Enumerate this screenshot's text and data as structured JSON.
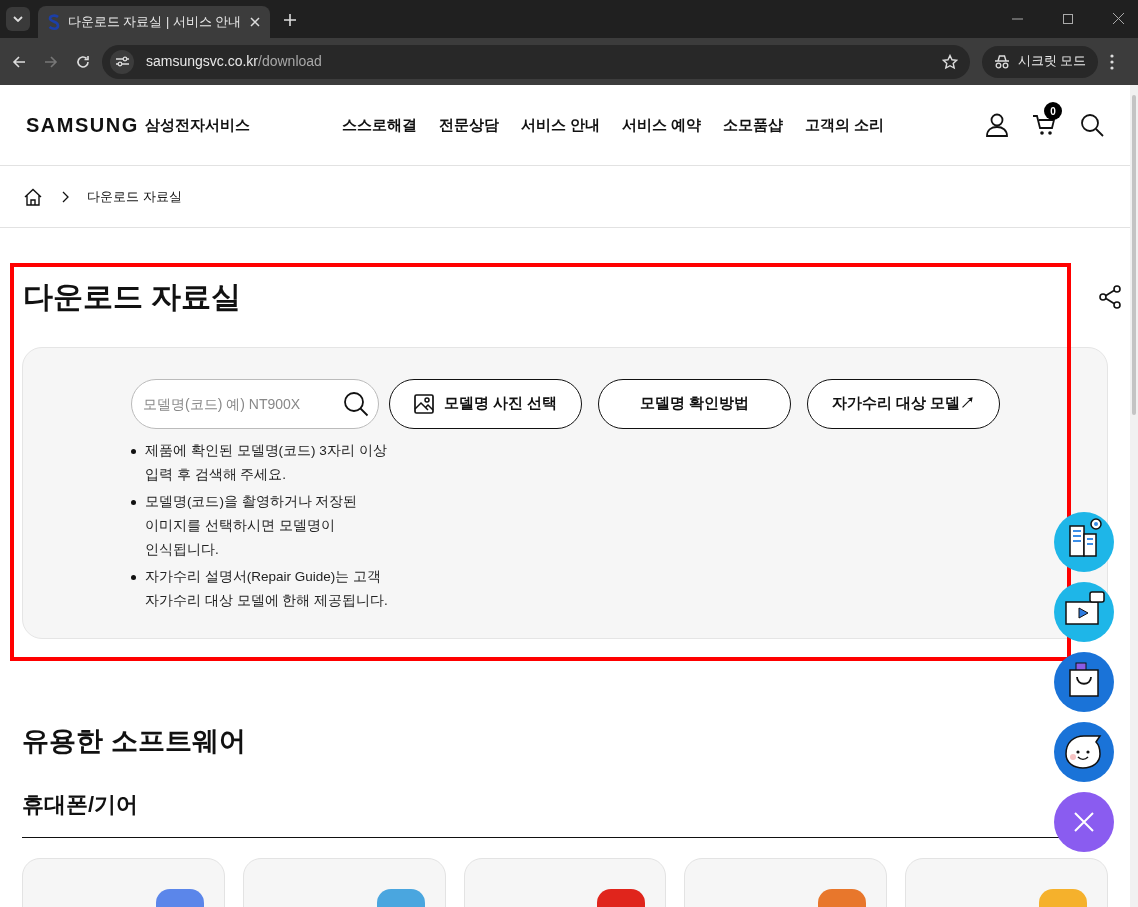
{
  "browser": {
    "tab_title": "다운로드 자료실 | 서비스 안내",
    "url_host": "samsungsvc.co.kr",
    "url_path": "/download",
    "incognito_label": "시크릿 모드"
  },
  "header": {
    "logo": "SAMSUNG",
    "brand": "삼성전자서비스",
    "nav": [
      "스스로해결",
      "전문상담",
      "서비스 안내",
      "서비스 예약",
      "소모품샵",
      "고객의 소리"
    ],
    "cart_count": "0"
  },
  "breadcrumb": [
    "다운로드 자료실"
  ],
  "page_title": "다운로드 자료실",
  "search": {
    "placeholder": "모델명(코드) 예) NT900X",
    "buttons": [
      {
        "kind": "photo",
        "label": "모델명 사진 선택"
      },
      {
        "kind": "plain",
        "label": "모델명 확인방법"
      },
      {
        "kind": "plain",
        "label": "자가수리 대상 모델↗"
      }
    ],
    "notes": [
      "제품에 확인된 모델명(코드) 3자리 이상 입력 후 검색해 주세요.",
      "모델명(코드)을 촬영하거나 저장된 이미지를 선택하시면 모델명이 인식됩니다.",
      "자가수리 설명서(Repair Guide)는 고객 자가수리 대상 모델에 한해 제공됩니다."
    ]
  },
  "software": {
    "title": "유용한 소프트웨어",
    "category": "휴대폰/기어",
    "cards": [
      {
        "color": "#5b86ea"
      },
      {
        "color": "#4aa6df"
      },
      {
        "color": "#e0251c"
      },
      {
        "color": "#e8772c"
      },
      {
        "color": "#f5b12c"
      }
    ]
  },
  "floating": [
    {
      "kind": "center"
    },
    {
      "kind": "video"
    },
    {
      "kind": "shop"
    },
    {
      "kind": "chat"
    },
    {
      "kind": "close"
    }
  ]
}
